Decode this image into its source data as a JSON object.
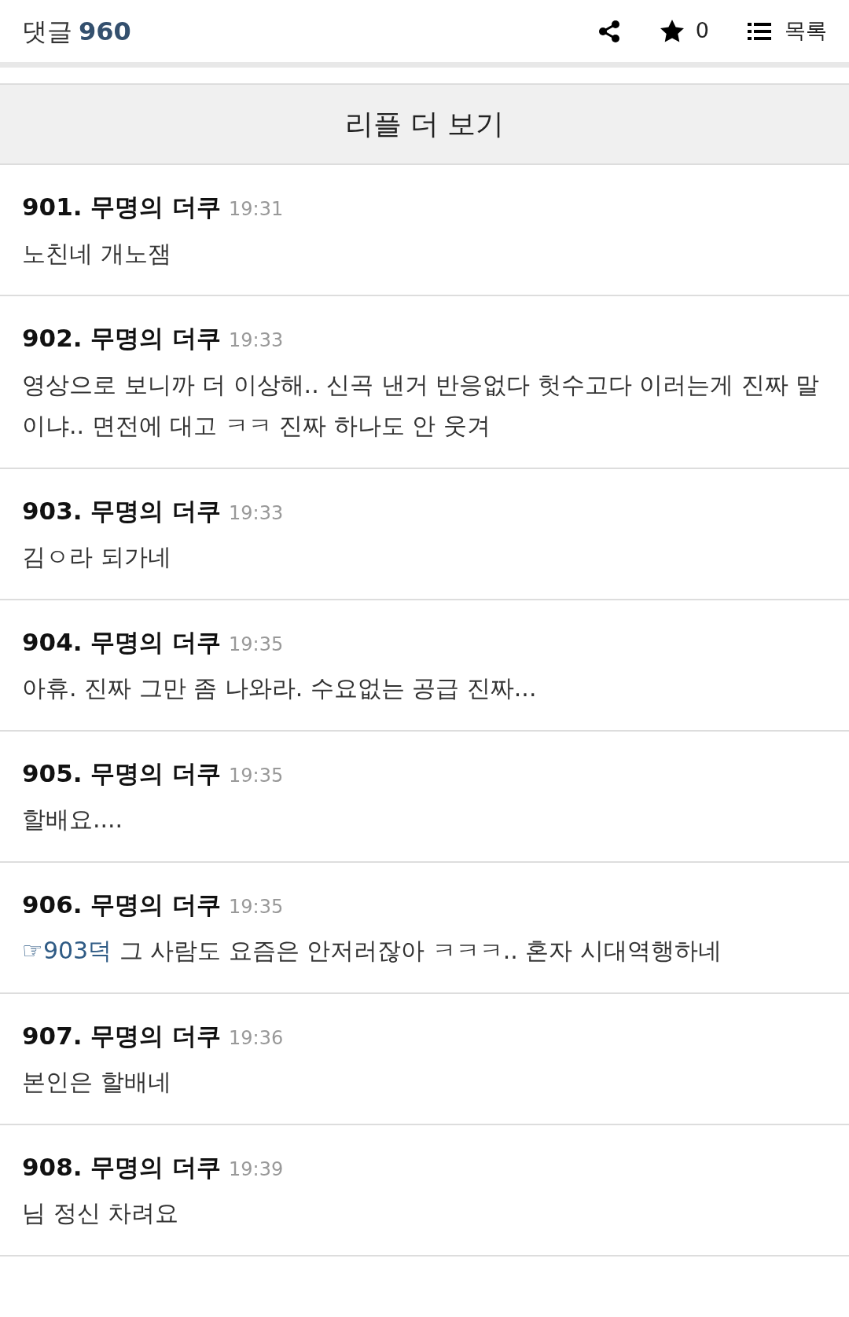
{
  "header": {
    "title": "댓글",
    "count": "960",
    "star_count": "0",
    "list_label": "목록"
  },
  "more_button": "리플 더 보기",
  "comments": [
    {
      "number": "901.",
      "author": "무명의 더쿠",
      "time": "19:31",
      "text": "노친네 개노잼"
    },
    {
      "number": "902.",
      "author": "무명의 더쿠",
      "time": "19:33",
      "text": "영상으로 보니까 더 이상해.. 신곡 낸거 반응없다 헛수고다 이러는게 진짜 말이냐.. 면전에 대고 ㅋㅋ 진짜 하나도 안 웃겨"
    },
    {
      "number": "903.",
      "author": "무명의 더쿠",
      "time": "19:33",
      "text": "김ㅇ라 되가네"
    },
    {
      "number": "904.",
      "author": "무명의 더쿠",
      "time": "19:35",
      "text": "아휴. 진짜 그만 좀 나와라. 수요없는 공급 진짜..."
    },
    {
      "number": "905.",
      "author": "무명의 더쿠",
      "time": "19:35",
      "text": "할배요...."
    },
    {
      "number": "906.",
      "author": "무명의 더쿠",
      "time": "19:35",
      "reply_to": "☞903덕",
      "text": "그 사람도 요즘은 안저러잖아 ㅋㅋㅋ.. 혼자 시대역행하네"
    },
    {
      "number": "907.",
      "author": "무명의 더쿠",
      "time": "19:36",
      "text": "본인은 할배네"
    },
    {
      "number": "908.",
      "author": "무명의 더쿠",
      "time": "19:39",
      "text": "님 정신 차려요"
    }
  ]
}
